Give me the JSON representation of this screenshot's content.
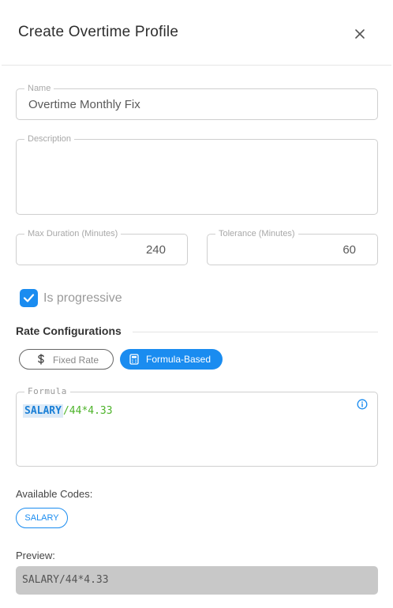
{
  "dialog": {
    "title": "Create Overtime Profile",
    "close_icon": "close-icon"
  },
  "form": {
    "name": {
      "label": "Name",
      "value": "Overtime Monthly Fix"
    },
    "description": {
      "label": "Description",
      "value": ""
    },
    "max_duration": {
      "label": "Max Duration (Minutes)",
      "value": "240"
    },
    "tolerance": {
      "label": "Tolerance (Minutes)",
      "value": "60"
    },
    "is_progressive": {
      "label": "Is progressive",
      "checked": true
    }
  },
  "rate_configurations": {
    "title": "Rate Configurations",
    "options": [
      {
        "label": "Fixed Rate",
        "icon": "dollar-icon",
        "selected": false
      },
      {
        "label": "Formula-Based",
        "icon": "calculator-icon",
        "selected": true
      }
    ]
  },
  "formula": {
    "label": "Formula",
    "code_token": "SALARY",
    "rest": "/44*4.33",
    "info_icon": "info-icon"
  },
  "available_codes": {
    "label": "Available Codes:",
    "codes": [
      "SALARY"
    ]
  },
  "preview": {
    "label": "Preview:",
    "value": "SALARY/44*4.33"
  },
  "colors": {
    "accent": "#1a8cf0",
    "formula_code": "#1a7fd6",
    "formula_rest": "#4db32a",
    "preview_bg": "#c8c8c8"
  }
}
